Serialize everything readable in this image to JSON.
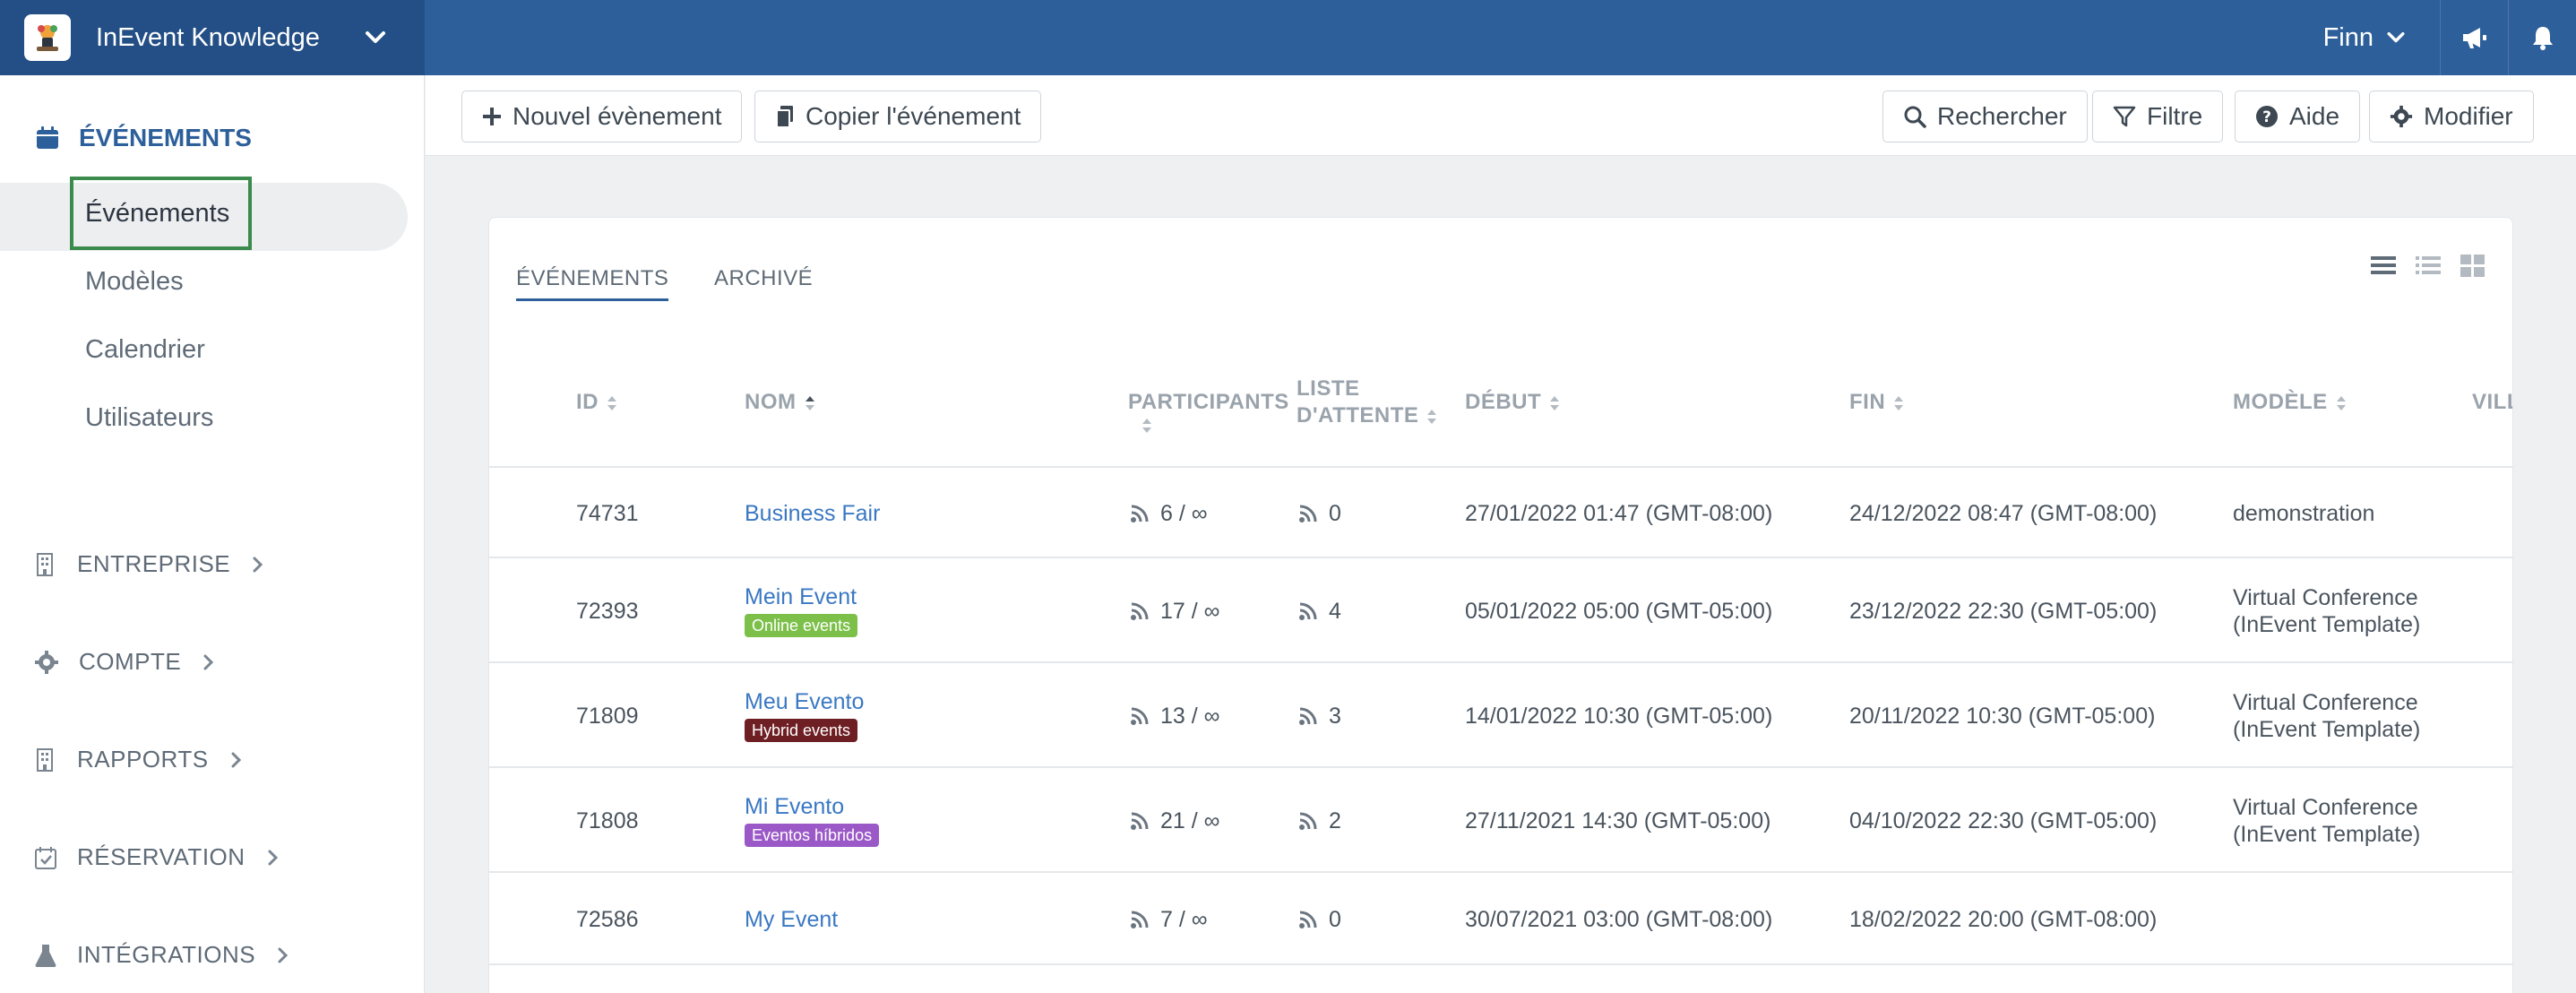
{
  "app": {
    "title": "InEvent Knowledge",
    "user": "Finn"
  },
  "sidebar": {
    "section_title": "ÉVÉNEMENTS",
    "sub_items": [
      "Événements",
      "Modèles",
      "Calendrier",
      "Utilisateurs"
    ],
    "groups": [
      "ENTREPRISE",
      "COMPTE",
      "RAPPORTS",
      "RÉSERVATION",
      "INTÉGRATIONS"
    ]
  },
  "toolbar": {
    "new_event": "Nouvel évènement",
    "copy_event": "Copier l'événement",
    "search": "Rechercher",
    "filter": "Filtre",
    "help": "Aide",
    "edit": "Modifier"
  },
  "tabs": {
    "events": "ÉVÉNEMENTS",
    "archived": "ARCHIVÉ"
  },
  "columns": {
    "id": "ID",
    "name": "NOM",
    "participants": "PARTICIPANTS",
    "waitlist_1": "LISTE",
    "waitlist_2": "D'ATTENTE",
    "start": "DÉBUT",
    "end": "FIN",
    "template": "MODÈLE",
    "city": "VILL"
  },
  "rows": [
    {
      "id": "74731",
      "name": "Business Fair",
      "tag": "",
      "participants": "6 / ∞",
      "waitlist": "0",
      "start": "27/01/2022 01:47 (GMT-08:00)",
      "end": "24/12/2022 08:47 (GMT-08:00)",
      "template_1": "demonstration",
      "template_2": ""
    },
    {
      "id": "72393",
      "name": "Mein Event",
      "tag": "Online events",
      "participants": "17 / ∞",
      "waitlist": "4",
      "start": "05/01/2022 05:00 (GMT-05:00)",
      "end": "23/12/2022 22:30 (GMT-05:00)",
      "template_1": "Virtual Conference",
      "template_2": "(InEvent Template)"
    },
    {
      "id": "71809",
      "name": "Meu Evento",
      "tag": "Hybrid events",
      "participants": "13 / ∞",
      "waitlist": "3",
      "start": "14/01/2022 10:30 (GMT-05:00)",
      "end": "20/11/2022 10:30 (GMT-05:00)",
      "template_1": "Virtual Conference",
      "template_2": "(InEvent Template)"
    },
    {
      "id": "71808",
      "name": "Mi Evento",
      "tag": "Eventos híbridos",
      "participants": "21 / ∞",
      "waitlist": "2",
      "start": "27/11/2021 14:30 (GMT-05:00)",
      "end": "04/10/2022 22:30 (GMT-05:00)",
      "template_1": "Virtual Conference",
      "template_2": "(InEvent Template)"
    },
    {
      "id": "72586",
      "name": "My Event",
      "tag": "",
      "participants": "7 / ∞",
      "waitlist": "0",
      "start": "30/07/2021 03:00 (GMT-08:00)",
      "end": "18/02/2022 20:00 (GMT-08:00)",
      "template_1": "",
      "template_2": ""
    }
  ],
  "colors": {
    "topbar": "#2d5f9a",
    "brand": "#234f86",
    "online_tag": "#7cc04a",
    "hybrid_tag": "#6e1f24",
    "hibrido_tag": "#9b59c7",
    "link": "#3a78c3"
  }
}
